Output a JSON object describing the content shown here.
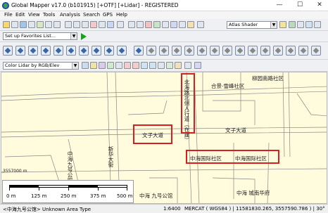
{
  "window": {
    "title": "Global Mapper v17.0 (b101915) [+OTF] [+Lidar] - REGISTERED",
    "minimize": "—",
    "maximize": "☐",
    "close": "✕"
  },
  "menu": [
    "File",
    "Edit",
    "View",
    "Tools",
    "Analysis",
    "Search",
    "GPS",
    "Help"
  ],
  "toolbar1": {
    "shader_select": "Atlas Shader"
  },
  "toolbar2": {
    "favorites_select": "Set up Favorites List..."
  },
  "toolbar4": {
    "lidar_color_select": "Color Lidar by RGB/Elev"
  },
  "map_labels": {
    "label_top_right": "柳园南路社区",
    "label_block": "合景·雪峰社区",
    "label_vertical_road": "北海路北侧人行道（在建）",
    "label_road_left": "文子大道",
    "label_road_right": "文子大道",
    "label_boulevard": "中海国际社区",
    "label_hl1": "中海国际社区",
    "label_hl2": "中海国际社区",
    "label_left_vertical": "中海九号公馆",
    "label_bottom_center": "中海 九号公馆",
    "label_bottom_right": "中海 城南华府",
    "label_mid_vertical": "新华大街",
    "coord_label": "3557000 m"
  },
  "scalebar": {
    "ticks": [
      "0 m",
      "125 m",
      "250 m",
      "375 m",
      "500 m"
    ]
  },
  "status": {
    "left": "<中海九号公馆> Unknown Area Type",
    "scale": "1:6400",
    "coords": "MERCAT ( WGS84 ) | 11581830.265, 3557590.786 ) | 30°"
  }
}
